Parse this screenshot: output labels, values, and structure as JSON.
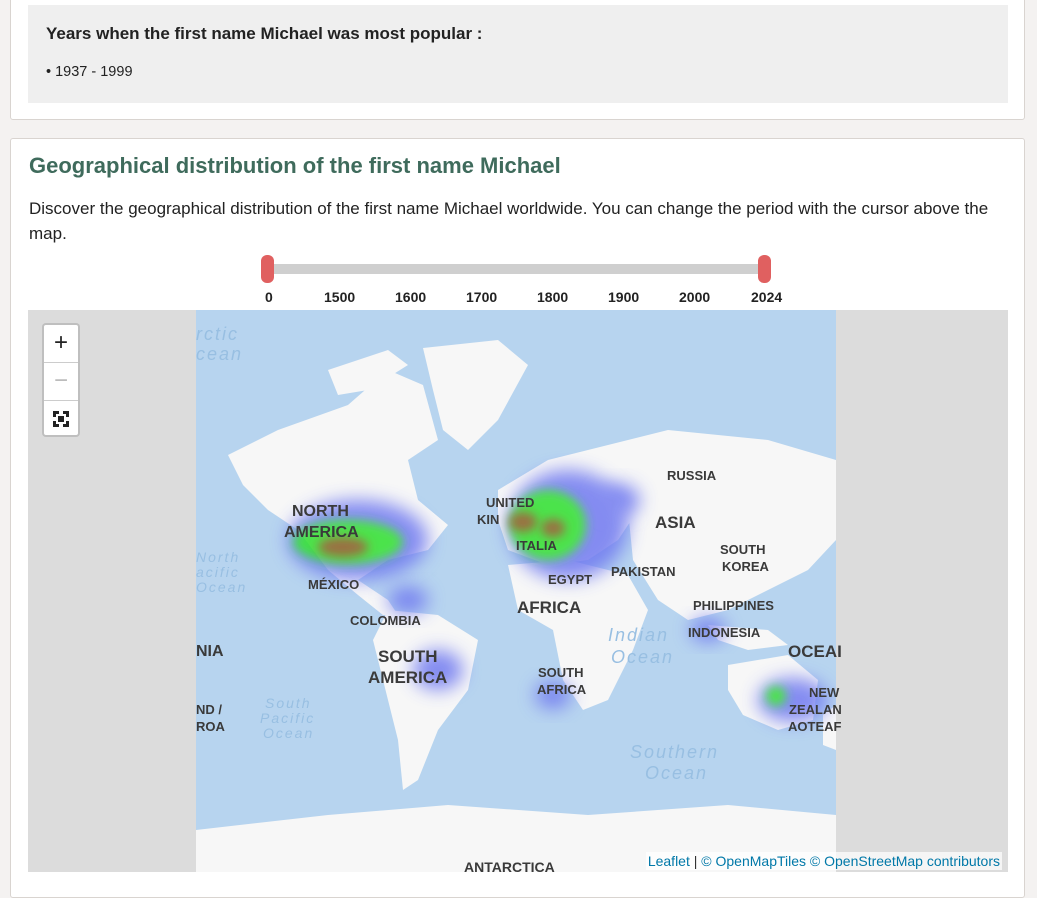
{
  "popular": {
    "title": "Years when the first name Michael was most popular :",
    "items": [
      "• 1937 - 1999"
    ]
  },
  "geo": {
    "title": "Geographical distribution of the first name Michael",
    "description": "Discover the geographical distribution of the first name Michael worldwide. You can change the period with the cursor above the map.",
    "slider": {
      "ticks": [
        "0",
        "1500",
        "1600",
        "1700",
        "1800",
        "1900",
        "2000",
        "2024"
      ],
      "min_value": "0",
      "max_value": "2024"
    }
  },
  "map": {
    "zoom_in": "+",
    "zoom_out": "−",
    "attribution": {
      "leaflet": "Leaflet",
      "sep": " | ",
      "omt": "© OpenMapTiles",
      "osm": "© OpenStreetMap contributors"
    },
    "labels": {
      "north_america_1": "NORTH",
      "north_america_2": "AMERICA",
      "mexico": "MÉXICO",
      "colombia": "COLOMBIA",
      "south_america_1": "SOUTH",
      "south_america_2": "AMERICA",
      "united": "UNITED",
      "kingdom": "KIN",
      "italia": "ITALIA",
      "egypt": "EGYPT",
      "africa": "AFRICA",
      "south_africa_1": "SOUTH",
      "south_africa_2": "AFRICA",
      "russia": "RUSSIA",
      "asia": "ASIA",
      "pakistan": "PAKISTAN",
      "south_korea_1": "SOUTH",
      "south_korea_2": "KOREA",
      "philippines": "PHILIPPINES",
      "indonesia": "INDONESIA",
      "oceania": "OCEAI",
      "nz_1": "NEW",
      "nz_2": "ZEALAN",
      "nz_3": "AOTEAF",
      "antarctica": "ANTARCTICA",
      "nia": "NIA",
      "nd": "ND /",
      "roa": "ROA",
      "arctic_1": "rctic",
      "arctic_2": "cean",
      "north_pacific_1": "North",
      "north_pacific_2": "acific",
      "north_pacific_3": "Ocean",
      "south_pacific_1": "South",
      "south_pacific_2": "Pacific",
      "south_pacific_3": "Ocean",
      "indian_1": "Indian",
      "indian_2": "Ocean",
      "southern_1": "Southern",
      "southern_2": "Ocean"
    }
  },
  "colors": {
    "title_green": "#3f6b5c",
    "slider_handle": "#e06060",
    "ocean": "#b7d4ef",
    "land": "#f7f7f7",
    "heat_high": "#2ee02e",
    "heat_peak": "#8a5a20",
    "heat_low": "#6f79f0"
  }
}
